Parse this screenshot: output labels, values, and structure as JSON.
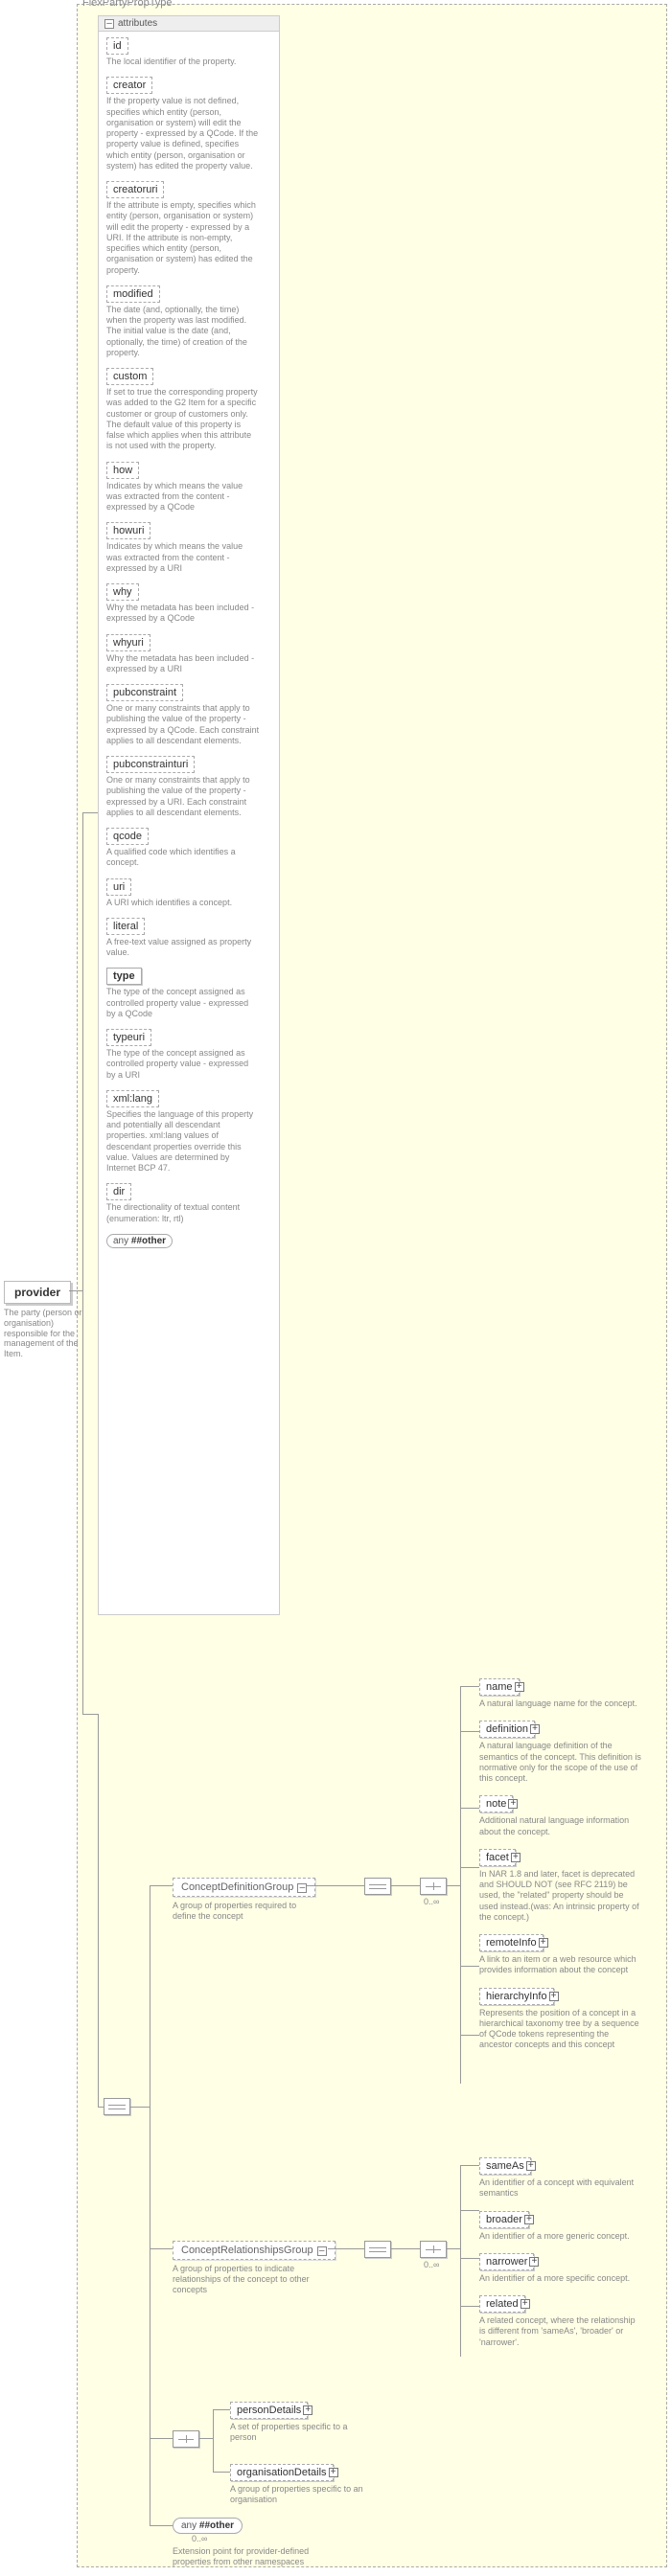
{
  "group": {
    "title": "FlexPartyPropType"
  },
  "root": {
    "name": "provider",
    "desc": "The party (person or organisation) responsible for the management of the Item."
  },
  "attributes_header": {
    "label": "attributes"
  },
  "attributes": [
    {
      "name": "id",
      "solid": false,
      "desc": "The local identifier of the property."
    },
    {
      "name": "creator",
      "solid": false,
      "desc": "If the property value is not defined, specifies which entity (person, organisation or system) will edit the property - expressed by a QCode. If the property value is defined, specifies which entity (person, organisation or system) has edited the property value."
    },
    {
      "name": "creatoruri",
      "solid": false,
      "desc": "If the attribute is empty, specifies which entity (person, organisation or system) will edit the property - expressed by a URI. If the attribute is non-empty, specifies which entity (person, organisation or system) has edited the property."
    },
    {
      "name": "modified",
      "solid": false,
      "desc": "The date (and, optionally, the time) when the property was last modified. The initial value is the date (and, optionally, the time) of creation of the property."
    },
    {
      "name": "custom",
      "solid": false,
      "desc": "If set to true the corresponding property was added to the G2 Item for a specific customer or group of customers only. The default value of this property is false which applies when this attribute is not used with the property."
    },
    {
      "name": "how",
      "solid": false,
      "desc": "Indicates by which means the value was extracted from the content - expressed by a QCode"
    },
    {
      "name": "howuri",
      "solid": false,
      "desc": "Indicates by which means the value was extracted from the content - expressed by a URI"
    },
    {
      "name": "why",
      "solid": false,
      "desc": "Why the metadata has been included - expressed by a QCode"
    },
    {
      "name": "whyuri",
      "solid": false,
      "desc": "Why the metadata has been included - expressed by a URI"
    },
    {
      "name": "pubconstraint",
      "solid": false,
      "desc": "One or many constraints that apply to publishing the value of the property - expressed by a QCode. Each constraint applies to all descendant elements."
    },
    {
      "name": "pubconstrainturi",
      "solid": false,
      "desc": "One or many constraints that apply to publishing the value of the property - expressed by a URI. Each constraint applies to all descendant elements."
    },
    {
      "name": "qcode",
      "solid": false,
      "desc": "A qualified code which identifies a concept."
    },
    {
      "name": "uri",
      "solid": false,
      "desc": "A URI which identifies a concept."
    },
    {
      "name": "literal",
      "solid": false,
      "desc": "A free-text value assigned as property value."
    },
    {
      "name": "type",
      "solid": true,
      "desc": "The type of the concept assigned as controlled property value - expressed by a QCode"
    },
    {
      "name": "typeuri",
      "solid": false,
      "desc": "The type of the concept assigned as controlled property value - expressed by a URI"
    },
    {
      "name": "xml:lang",
      "solid": false,
      "desc": "Specifies the language of this property and potentially all descendant properties. xml:lang values of descendant properties override this value. Values are determined by Internet BCP 47."
    },
    {
      "name": "dir",
      "solid": false,
      "desc": "The directionality of textual content (enumeration: ltr, rtl)"
    }
  ],
  "attr_any": {
    "prefix": "any",
    "rest": "##other"
  },
  "groups": [
    {
      "name": "ConceptDefinitionGroup",
      "desc": "A group of properties required to define the concept",
      "occ": "0..∞",
      "children": [
        {
          "name": "name",
          "dashed": true,
          "desc": "A natural language name for the concept."
        },
        {
          "name": "definition",
          "dashed": true,
          "desc": "A natural language definition of the semantics of the concept. This definition is normative only for the scope of the use of this concept."
        },
        {
          "name": "note",
          "dashed": true,
          "desc": "Additional natural language information about the concept."
        },
        {
          "name": "facet",
          "dashed": true,
          "desc": "In NAR 1.8 and later, facet is deprecated and SHOULD NOT (see RFC 2119) be used, the \"related\" property should be used instead.(was: An intrinsic property of the concept.)"
        },
        {
          "name": "remoteInfo",
          "dashed": true,
          "desc": "A link to an item or a web resource which provides information about the concept"
        },
        {
          "name": "hierarchyInfo",
          "dashed": true,
          "desc": "Represents the position of a concept in a hierarchical taxonomy tree by a sequence of QCode tokens representing the ancestor concepts and this concept"
        }
      ]
    },
    {
      "name": "ConceptRelationshipsGroup",
      "desc": "A group of properties to indicate relationships of the concept to other concepts",
      "occ": "0..∞",
      "children": [
        {
          "name": "sameAs",
          "dashed": true,
          "desc": "An identifier of a concept with equivalent semantics"
        },
        {
          "name": "broader",
          "dashed": true,
          "desc": "An identifier of a more generic concept."
        },
        {
          "name": "narrower",
          "dashed": true,
          "desc": "An identifier of a more specific concept."
        },
        {
          "name": "related",
          "dashed": true,
          "desc": "A related concept, where the relationship is different from 'sameAs', 'broader' or 'narrower'."
        }
      ]
    }
  ],
  "details_children": [
    {
      "name": "personDetails",
      "desc": "A set of properties specific to a person"
    },
    {
      "name": "organisationDetails",
      "desc": "A group of properties specific to an organisation"
    }
  ],
  "bottom_any": {
    "prefix": "any",
    "rest": "##other",
    "occ": "0..∞",
    "desc": "Extension point for provider-defined properties from other namespaces"
  }
}
